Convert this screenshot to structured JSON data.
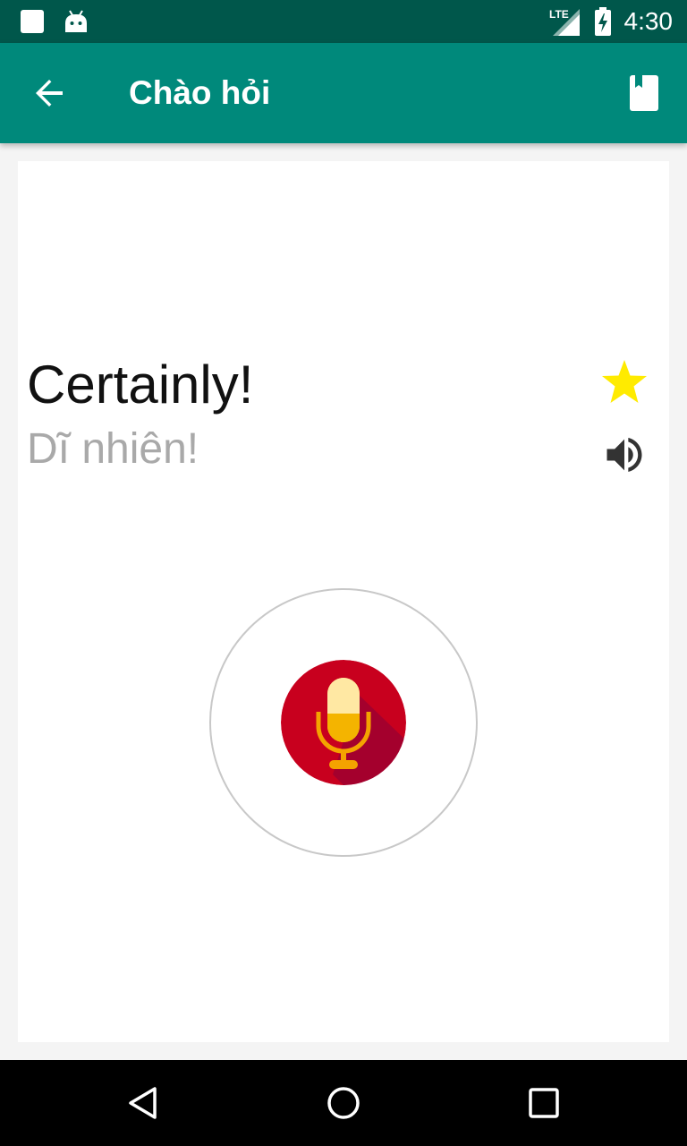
{
  "status_bar": {
    "time": "4:30",
    "network": "LTE",
    "icons": [
      "notification-square-icon",
      "android-icon",
      "lte-signal-icon",
      "battery-charging-icon"
    ]
  },
  "app_bar": {
    "title": "Chào hỏi",
    "back_icon": "arrow-back-icon",
    "bookmark_icon": "bookmark-book-icon",
    "background": "#00897b"
  },
  "phrase": {
    "english": "Certainly!",
    "vietnamese": "Dĩ nhiên!",
    "favorite": true,
    "favorite_color": "#ffeb00"
  },
  "microphone": {
    "icon": "microphone-icon",
    "color": "#c8001e"
  },
  "nav_bar": {
    "icons": [
      "nav-back-icon",
      "nav-home-icon",
      "nav-recents-icon"
    ]
  }
}
